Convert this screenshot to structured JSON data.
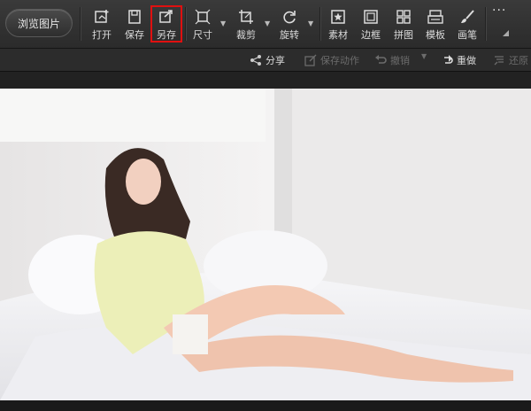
{
  "toolbar": {
    "browse_label": "浏览图片",
    "tools": [
      {
        "label": "打开",
        "icon": "open-icon"
      },
      {
        "label": "保存",
        "icon": "save-icon"
      },
      {
        "label": "另存",
        "icon": "save-as-icon"
      },
      {
        "label": "尺寸",
        "icon": "resize-icon"
      },
      {
        "label": "裁剪",
        "icon": "crop-icon"
      },
      {
        "label": "旋转",
        "icon": "rotate-icon"
      },
      {
        "label": "素材",
        "icon": "sticker-icon"
      },
      {
        "label": "边框",
        "icon": "frame-icon"
      },
      {
        "label": "拼图",
        "icon": "collage-icon"
      },
      {
        "label": "模板",
        "icon": "template-icon"
      },
      {
        "label": "画笔",
        "icon": "brush-icon"
      }
    ],
    "more_label": "···"
  },
  "subbar": {
    "share_label": "分享",
    "save_action_label": "保存动作",
    "undo_label": "撤销",
    "redo_label": "重做",
    "restore_label": "还原"
  },
  "colors": {
    "highlight": "#e01010",
    "toolbar_bg": "#2f2f2f"
  }
}
